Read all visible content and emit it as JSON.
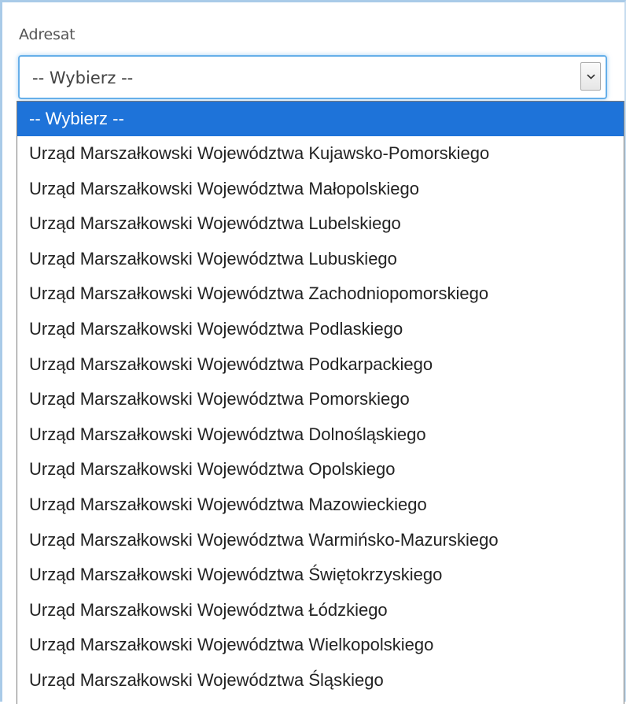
{
  "field": {
    "label": "Adresat",
    "selected_value": "-- Wybierz --"
  },
  "colors": {
    "highlight": "#1e73d9",
    "focus_border": "#66afe9"
  },
  "dropdown": {
    "options": [
      "-- Wybierz --",
      "Urząd Marszałkowski Województwa Kujawsko-Pomorskiego",
      "Urząd Marszałkowski Województwa Małopolskiego",
      "Urząd Marszałkowski Województwa Lubelskiego",
      "Urząd Marszałkowski Województwa Lubuskiego",
      "Urząd Marszałkowski Województwa Zachodniopomorskiego",
      "Urząd Marszałkowski Województwa Podlaskiego",
      "Urząd Marszałkowski Województwa Podkarpackiego",
      "Urząd Marszałkowski Województwa Pomorskiego",
      "Urząd Marszałkowski Województwa Dolnośląskiego",
      "Urząd Marszałkowski Województwa Opolskiego",
      "Urząd Marszałkowski Województwa Mazowieckiego",
      "Urząd Marszałkowski Województwa Warmińsko-Mazurskiego",
      "Urząd Marszałkowski Województwa Świętokrzyskiego",
      "Urząd Marszałkowski Województwa Łódzkiego",
      "Urząd Marszałkowski Województwa Wielkopolskiego",
      "Urząd Marszałkowski Województwa Śląskiego"
    ],
    "highlighted_index": 0,
    "arrow_icon": "chevron-down-icon"
  }
}
